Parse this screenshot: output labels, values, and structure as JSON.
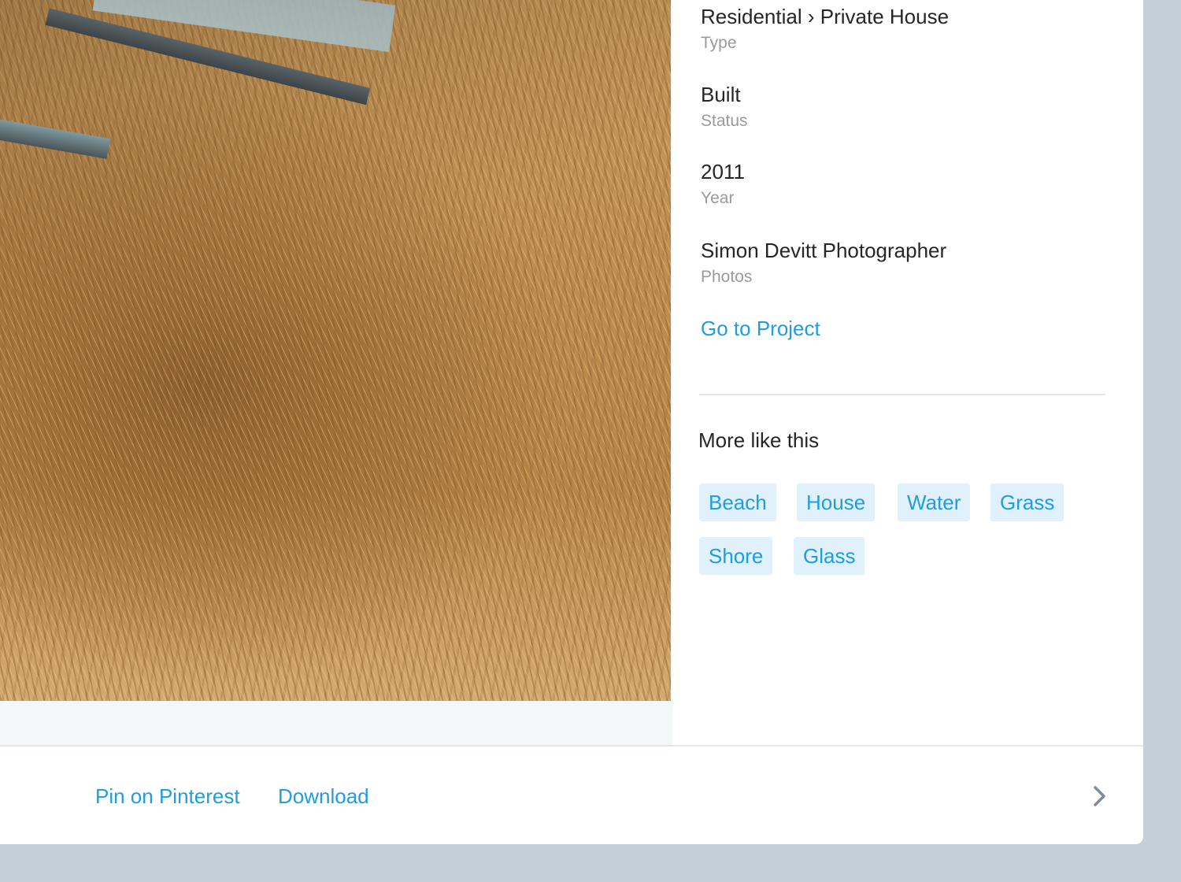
{
  "details": {
    "type_value": "Residential › Private House",
    "type_label": "Type",
    "status_value": "Built",
    "status_label": "Status",
    "year_value": "2011",
    "year_label": "Year",
    "photos_value": "Simon Devitt Photographer",
    "photos_label": "Photos",
    "go_to_project": "Go to Project"
  },
  "more": {
    "title": "More like this",
    "tags": [
      "Beach",
      "House",
      "Water",
      "Grass",
      "Shore",
      "Glass"
    ]
  },
  "footer": {
    "pin_label": "Pin on Pinterest",
    "download_label": "Download",
    "next_icon": "chevron-right-icon"
  },
  "colors": {
    "link": "#1e9de0",
    "tag_bg": "#e0f1fb",
    "page_bg": "#c5cfd8",
    "text": "#262626",
    "muted": "#9a9a9a"
  }
}
